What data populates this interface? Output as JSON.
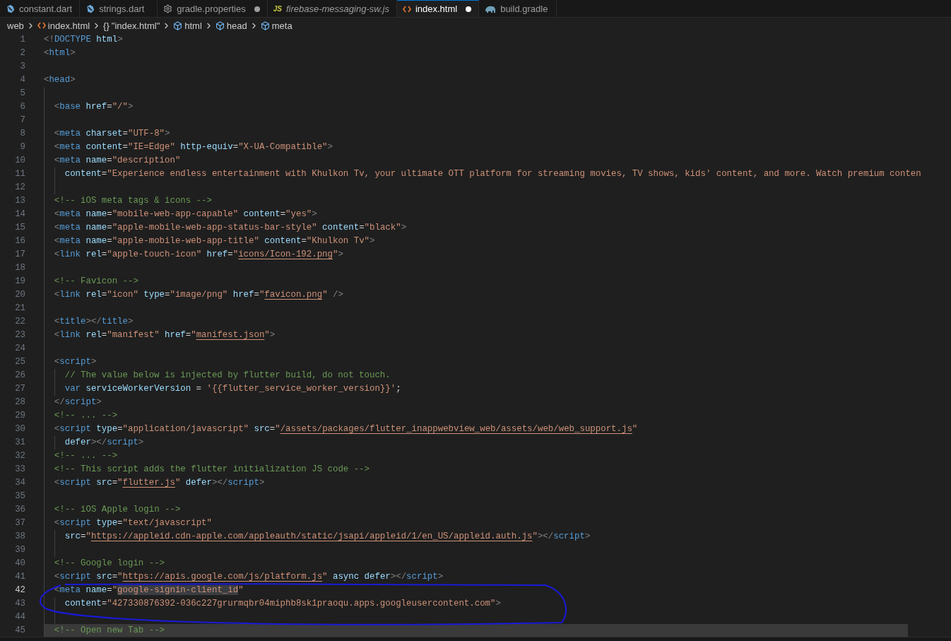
{
  "tabs": [
    {
      "label": "constant.dart",
      "kind": "dart",
      "selected": false,
      "modified": false,
      "preview": false
    },
    {
      "label": "strings.dart",
      "kind": "dart",
      "selected": false,
      "modified": false,
      "preview": false
    },
    {
      "label": "gradle.properties",
      "kind": "gear",
      "selected": false,
      "modified": true,
      "preview": false
    },
    {
      "label": "firebase-messaging-sw.js",
      "kind": "js",
      "badge": "JS",
      "selected": false,
      "modified": false,
      "preview": true
    },
    {
      "label": "index.html",
      "kind": "html",
      "selected": true,
      "modified": true,
      "preview": false
    },
    {
      "label": "build.gradle",
      "kind": "gradle",
      "selected": false,
      "modified": false,
      "preview": false
    }
  ],
  "breadcrumbs": [
    {
      "label": "web",
      "kind": "folder"
    },
    {
      "label": "index.html",
      "kind": "html"
    },
    {
      "label": "\"index.html\"",
      "kind": "braces",
      "glyph": "{}"
    },
    {
      "label": "html",
      "kind": "element"
    },
    {
      "label": "head",
      "kind": "element"
    },
    {
      "label": "meta",
      "kind": "element"
    }
  ],
  "editor": {
    "lines": [
      {
        "n": "1",
        "current": false,
        "shaded": false,
        "tokens": [
          {
            "text": "<!",
            "kind": "p"
          },
          {
            "text": "DOCTYPE",
            "kind": "tag"
          },
          {
            "text": " html",
            "kind": "attr"
          },
          {
            "text": ">",
            "kind": "p"
          }
        ]
      },
      {
        "n": "2",
        "current": false,
        "shaded": false,
        "tokens": [
          {
            "text": "<",
            "kind": "p"
          },
          {
            "text": "html",
            "kind": "tag"
          },
          {
            "text": ">",
            "kind": "p"
          }
        ]
      },
      {
        "n": "3",
        "current": false,
        "shaded": false
      },
      {
        "n": "4",
        "current": false,
        "shaded": false,
        "tokens": [
          {
            "text": "<",
            "kind": "p"
          },
          {
            "text": "head",
            "kind": "tag"
          },
          {
            "text": ">",
            "kind": "p"
          }
        ]
      },
      {
        "n": "5",
        "current": false,
        "shaded": false,
        "tokens": [
          {
            "kind": "guide"
          }
        ]
      },
      {
        "n": "6",
        "current": false,
        "shaded": false,
        "tokens": [
          {
            "kind": "guide"
          },
          {
            "text": "<",
            "kind": "p"
          },
          {
            "text": "base",
            "kind": "tag"
          },
          {
            "text": " href",
            "kind": "attr"
          },
          {
            "text": "=",
            "kind": "op"
          },
          {
            "text": "\"/\"",
            "kind": "str"
          },
          {
            "text": ">",
            "kind": "p"
          }
        ]
      },
      {
        "n": "7",
        "current": false,
        "shaded": false,
        "tokens": [
          {
            "kind": "guide"
          }
        ]
      },
      {
        "n": "8",
        "current": false,
        "shaded": false,
        "tokens": [
          {
            "kind": "guide"
          },
          {
            "text": "<",
            "kind": "p"
          },
          {
            "text": "meta",
            "kind": "tag"
          },
          {
            "text": " charset",
            "kind": "attr"
          },
          {
            "text": "=",
            "kind": "op"
          },
          {
            "text": "\"UTF-8\"",
            "kind": "str"
          },
          {
            "text": ">",
            "kind": "p"
          }
        ]
      },
      {
        "n": "9",
        "current": false,
        "shaded": false,
        "tokens": [
          {
            "kind": "guide"
          },
          {
            "text": "<",
            "kind": "p"
          },
          {
            "text": "meta",
            "kind": "tag"
          },
          {
            "text": " content",
            "kind": "attr"
          },
          {
            "text": "=",
            "kind": "op"
          },
          {
            "text": "\"IE=Edge\"",
            "kind": "str"
          },
          {
            "text": " http-equiv",
            "kind": "attr"
          },
          {
            "text": "=",
            "kind": "op"
          },
          {
            "text": "\"X-UA-Compatible\"",
            "kind": "str"
          },
          {
            "text": ">",
            "kind": "p"
          }
        ]
      },
      {
        "n": "10",
        "current": false,
        "shaded": false,
        "tokens": [
          {
            "kind": "guide"
          },
          {
            "text": "<",
            "kind": "p"
          },
          {
            "text": "meta",
            "kind": "tag"
          },
          {
            "text": " name",
            "kind": "attr"
          },
          {
            "text": "=",
            "kind": "op"
          },
          {
            "text": "\"description\"",
            "kind": "str"
          }
        ]
      },
      {
        "n": "11",
        "current": false,
        "shaded": false,
        "tokens": [
          {
            "kind": "guide"
          },
          {
            "kind": "guide"
          },
          {
            "text": "content",
            "kind": "attr"
          },
          {
            "text": "=",
            "kind": "op"
          },
          {
            "text": "\"Experience endless entertainment with Khulkon Tv, your ultimate OTT platform for streaming movies, TV shows, kids' content, and more. Watch premium conten",
            "kind": "str"
          }
        ]
      },
      {
        "n": "12",
        "current": false,
        "shaded": false,
        "tokens": [
          {
            "kind": "guide"
          },
          {
            "kind": "guide"
          }
        ]
      },
      {
        "n": "13",
        "current": false,
        "shaded": false,
        "tokens": [
          {
            "kind": "guide"
          },
          {
            "text": "<!-- iOS meta tags & icons -->",
            "kind": "com"
          }
        ]
      },
      {
        "n": "14",
        "current": false,
        "shaded": false,
        "tokens": [
          {
            "kind": "guide"
          },
          {
            "text": "<",
            "kind": "p"
          },
          {
            "text": "meta",
            "kind": "tag"
          },
          {
            "text": " name",
            "kind": "attr"
          },
          {
            "text": "=",
            "kind": "op"
          },
          {
            "text": "\"mobile-web-app-capable\"",
            "kind": "str"
          },
          {
            "text": " content",
            "kind": "attr"
          },
          {
            "text": "=",
            "kind": "op"
          },
          {
            "text": "\"yes\"",
            "kind": "str"
          },
          {
            "text": ">",
            "kind": "p"
          }
        ]
      },
      {
        "n": "15",
        "current": false,
        "shaded": false,
        "tokens": [
          {
            "kind": "guide"
          },
          {
            "text": "<",
            "kind": "p"
          },
          {
            "text": "meta",
            "kind": "tag"
          },
          {
            "text": " name",
            "kind": "attr"
          },
          {
            "text": "=",
            "kind": "op"
          },
          {
            "text": "\"apple-mobile-web-app-status-bar-style\"",
            "kind": "str"
          },
          {
            "text": " content",
            "kind": "attr"
          },
          {
            "text": "=",
            "kind": "op"
          },
          {
            "text": "\"black\"",
            "kind": "str"
          },
          {
            "text": ">",
            "kind": "p"
          }
        ]
      },
      {
        "n": "16",
        "current": false,
        "shaded": false,
        "tokens": [
          {
            "kind": "guide"
          },
          {
            "text": "<",
            "kind": "p"
          },
          {
            "text": "meta",
            "kind": "tag"
          },
          {
            "text": " name",
            "kind": "attr"
          },
          {
            "text": "=",
            "kind": "op"
          },
          {
            "text": "\"apple-mobile-web-app-title\"",
            "kind": "str"
          },
          {
            "text": " content",
            "kind": "attr"
          },
          {
            "text": "=",
            "kind": "op"
          },
          {
            "text": "\"Khulkon Tv\"",
            "kind": "str"
          },
          {
            "text": ">",
            "kind": "p"
          }
        ]
      },
      {
        "n": "17",
        "current": false,
        "shaded": false,
        "tokens": [
          {
            "kind": "guide"
          },
          {
            "text": "<",
            "kind": "p"
          },
          {
            "text": "link",
            "kind": "tag"
          },
          {
            "text": " rel",
            "kind": "attr"
          },
          {
            "text": "=",
            "kind": "op"
          },
          {
            "text": "\"apple-touch-icon\"",
            "kind": "str"
          },
          {
            "text": " href",
            "kind": "attr"
          },
          {
            "text": "=",
            "kind": "op"
          },
          {
            "text": "\"",
            "kind": "str"
          },
          {
            "text": "icons/Icon-192.png",
            "kind": "link"
          },
          {
            "text": "\"",
            "kind": "str"
          },
          {
            "text": ">",
            "kind": "p"
          }
        ]
      },
      {
        "n": "18",
        "current": false,
        "shaded": false,
        "tokens": [
          {
            "kind": "guide"
          }
        ]
      },
      {
        "n": "19",
        "current": false,
        "shaded": false,
        "tokens": [
          {
            "kind": "guide"
          },
          {
            "text": "<!-- Favicon -->",
            "kind": "com"
          }
        ]
      },
      {
        "n": "20",
        "current": false,
        "shaded": false,
        "tokens": [
          {
            "kind": "guide"
          },
          {
            "text": "<",
            "kind": "p"
          },
          {
            "text": "link",
            "kind": "tag"
          },
          {
            "text": " rel",
            "kind": "attr"
          },
          {
            "text": "=",
            "kind": "op"
          },
          {
            "text": "\"icon\"",
            "kind": "str"
          },
          {
            "text": " type",
            "kind": "attr"
          },
          {
            "text": "=",
            "kind": "op"
          },
          {
            "text": "\"image/png\"",
            "kind": "str"
          },
          {
            "text": " href",
            "kind": "attr"
          },
          {
            "text": "=",
            "kind": "op"
          },
          {
            "text": "\"",
            "kind": "str"
          },
          {
            "text": "favicon.png",
            "kind": "link"
          },
          {
            "text": "\"",
            "kind": "str"
          },
          {
            "text": " />",
            "kind": "p"
          }
        ]
      },
      {
        "n": "21",
        "current": false,
        "shaded": false,
        "tokens": [
          {
            "kind": "guide"
          }
        ]
      },
      {
        "n": "22",
        "current": false,
        "shaded": false,
        "tokens": [
          {
            "kind": "guide"
          },
          {
            "text": "<",
            "kind": "p"
          },
          {
            "text": "title",
            "kind": "tag"
          },
          {
            "text": "></",
            "kind": "p"
          },
          {
            "text": "title",
            "kind": "tag"
          },
          {
            "text": ">",
            "kind": "p"
          }
        ]
      },
      {
        "n": "23",
        "current": false,
        "shaded": false,
        "tokens": [
          {
            "kind": "guide"
          },
          {
            "text": "<",
            "kind": "p"
          },
          {
            "text": "link",
            "kind": "tag"
          },
          {
            "text": " rel",
            "kind": "attr"
          },
          {
            "text": "=",
            "kind": "op"
          },
          {
            "text": "\"manifest\"",
            "kind": "str"
          },
          {
            "text": " href",
            "kind": "attr"
          },
          {
            "text": "=",
            "kind": "op"
          },
          {
            "text": "\"",
            "kind": "str"
          },
          {
            "text": "manifest.json",
            "kind": "link"
          },
          {
            "text": "\"",
            "kind": "str"
          },
          {
            "text": ">",
            "kind": "p"
          }
        ]
      },
      {
        "n": "24",
        "current": false,
        "shaded": false,
        "tokens": [
          {
            "kind": "guide"
          }
        ]
      },
      {
        "n": "25",
        "current": false,
        "shaded": false,
        "tokens": [
          {
            "kind": "guide"
          },
          {
            "text": "<",
            "kind": "p"
          },
          {
            "text": "script",
            "kind": "tag"
          },
          {
            "text": ">",
            "kind": "p"
          }
        ]
      },
      {
        "n": "26",
        "current": false,
        "shaded": false,
        "tokens": [
          {
            "kind": "guide"
          },
          {
            "kind": "guide"
          },
          {
            "text": "// The value below is injected by flutter build, do not touch.",
            "kind": "com"
          }
        ]
      },
      {
        "n": "27",
        "current": false,
        "shaded": false,
        "tokens": [
          {
            "kind": "guide"
          },
          {
            "kind": "guide"
          },
          {
            "text": "var",
            "kind": "kw"
          },
          {
            "text": " serviceWorkerVersion",
            "kind": "var"
          },
          {
            "text": " = ",
            "kind": "op"
          },
          {
            "text": "'{{flutter_service_worker_version}}'",
            "kind": "str"
          },
          {
            "text": ";",
            "kind": "op"
          }
        ]
      },
      {
        "n": "28",
        "current": false,
        "shaded": false,
        "tokens": [
          {
            "kind": "guide"
          },
          {
            "text": "</",
            "kind": "p"
          },
          {
            "text": "script",
            "kind": "tag"
          },
          {
            "text": ">",
            "kind": "p"
          }
        ]
      },
      {
        "n": "29",
        "current": false,
        "shaded": false,
        "tokens": [
          {
            "kind": "guide"
          },
          {
            "text": "<!-- ... -->",
            "kind": "com"
          }
        ]
      },
      {
        "n": "30",
        "current": false,
        "shaded": false,
        "tokens": [
          {
            "kind": "guide"
          },
          {
            "text": "<",
            "kind": "p"
          },
          {
            "text": "script",
            "kind": "tag"
          },
          {
            "text": " type",
            "kind": "attr"
          },
          {
            "text": "=",
            "kind": "op"
          },
          {
            "text": "\"application/javascript\"",
            "kind": "str"
          },
          {
            "text": " src",
            "kind": "attr"
          },
          {
            "text": "=",
            "kind": "op"
          },
          {
            "text": "\"",
            "kind": "str"
          },
          {
            "text": "/assets/packages/flutter_inappwebview_web/assets/web/web_support.js",
            "kind": "link"
          },
          {
            "text": "\"",
            "kind": "str"
          }
        ]
      },
      {
        "n": "31",
        "current": false,
        "shaded": false,
        "tokens": [
          {
            "kind": "guide"
          },
          {
            "kind": "guide"
          },
          {
            "text": "defer",
            "kind": "attr"
          },
          {
            "text": "></",
            "kind": "p"
          },
          {
            "text": "script",
            "kind": "tag"
          },
          {
            "text": ">",
            "kind": "p"
          }
        ]
      },
      {
        "n": "32",
        "current": false,
        "shaded": false,
        "tokens": [
          {
            "kind": "guide"
          },
          {
            "text": "<!-- ... -->",
            "kind": "com"
          }
        ]
      },
      {
        "n": "33",
        "current": false,
        "shaded": false,
        "tokens": [
          {
            "kind": "guide"
          },
          {
            "text": "<!-- This script adds the flutter initialization JS code -->",
            "kind": "com"
          }
        ]
      },
      {
        "n": "34",
        "current": false,
        "shaded": false,
        "tokens": [
          {
            "kind": "guide"
          },
          {
            "text": "<",
            "kind": "p"
          },
          {
            "text": "script",
            "kind": "tag"
          },
          {
            "text": " src",
            "kind": "attr"
          },
          {
            "text": "=",
            "kind": "op"
          },
          {
            "text": "\"",
            "kind": "str"
          },
          {
            "text": "flutter.js",
            "kind": "link"
          },
          {
            "text": "\"",
            "kind": "str"
          },
          {
            "text": " defer",
            "kind": "attr"
          },
          {
            "text": "></",
            "kind": "p"
          },
          {
            "text": "script",
            "kind": "tag"
          },
          {
            "text": ">",
            "kind": "p"
          }
        ]
      },
      {
        "n": "35",
        "current": false,
        "shaded": false,
        "tokens": [
          {
            "kind": "guide"
          }
        ]
      },
      {
        "n": "36",
        "current": false,
        "shaded": false,
        "tokens": [
          {
            "kind": "guide"
          },
          {
            "text": "<!-- iOS Apple login -->",
            "kind": "com"
          }
        ]
      },
      {
        "n": "37",
        "current": false,
        "shaded": false,
        "tokens": [
          {
            "kind": "guide"
          },
          {
            "text": "<",
            "kind": "p"
          },
          {
            "text": "script",
            "kind": "tag"
          },
          {
            "text": " type",
            "kind": "attr"
          },
          {
            "text": "=",
            "kind": "op"
          },
          {
            "text": "\"text/javascript\"",
            "kind": "str"
          }
        ]
      },
      {
        "n": "38",
        "current": false,
        "shaded": false,
        "tokens": [
          {
            "kind": "guide"
          },
          {
            "kind": "guide"
          },
          {
            "text": "src",
            "kind": "attr"
          },
          {
            "text": "=",
            "kind": "op"
          },
          {
            "text": "\"",
            "kind": "str"
          },
          {
            "text": "https://appleid.cdn-apple.com/appleauth/static/jsapi/appleid/1/en_US/appleid.auth.js",
            "kind": "link"
          },
          {
            "text": "\"",
            "kind": "str"
          },
          {
            "text": "></",
            "kind": "p"
          },
          {
            "text": "script",
            "kind": "tag"
          },
          {
            "text": ">",
            "kind": "p"
          }
        ]
      },
      {
        "n": "39",
        "current": false,
        "shaded": false,
        "tokens": [
          {
            "kind": "guide"
          },
          {
            "kind": "guide"
          }
        ]
      },
      {
        "n": "40",
        "current": false,
        "shaded": false,
        "tokens": [
          {
            "kind": "guide"
          },
          {
            "text": "<!-- Google login -->",
            "kind": "com"
          }
        ]
      },
      {
        "n": "41",
        "current": false,
        "shaded": false,
        "tokens": [
          {
            "kind": "guide"
          },
          {
            "text": "<",
            "kind": "p"
          },
          {
            "text": "script",
            "kind": "tag"
          },
          {
            "text": " src",
            "kind": "attr"
          },
          {
            "text": "=",
            "kind": "op"
          },
          {
            "text": "\"",
            "kind": "str"
          },
          {
            "text": "https://apis.google.com/js/platform.js",
            "kind": "link"
          },
          {
            "text": "\"",
            "kind": "str"
          },
          {
            "text": " async",
            "kind": "attr"
          },
          {
            "text": " defer",
            "kind": "attr"
          },
          {
            "text": "></",
            "kind": "p"
          },
          {
            "text": "script",
            "kind": "tag"
          },
          {
            "text": ">",
            "kind": "p"
          }
        ]
      },
      {
        "n": "42",
        "current": true,
        "shaded": false,
        "tokens": [
          {
            "kind": "guide"
          },
          {
            "text": "<",
            "kind": "p"
          },
          {
            "text": "meta",
            "kind": "tag"
          },
          {
            "text": " name",
            "kind": "attr"
          },
          {
            "text": "=",
            "kind": "op"
          },
          {
            "text": "\"",
            "kind": "str"
          },
          {
            "text": "google-signin-client_id",
            "kind": "sel"
          },
          {
            "text": "\"",
            "kind": "str"
          }
        ]
      },
      {
        "n": "43",
        "current": false,
        "shaded": false,
        "tokens": [
          {
            "kind": "guide"
          },
          {
            "kind": "guide"
          },
          {
            "text": "content",
            "kind": "attr"
          },
          {
            "text": "=",
            "kind": "op"
          },
          {
            "text": "\"427330876392-036c227grurmqbr04miphb8sk1praoqu.apps.googleusercontent.com\"",
            "kind": "str"
          },
          {
            "text": ">",
            "kind": "p"
          }
        ]
      },
      {
        "n": "44",
        "current": false,
        "shaded": false,
        "tokens": [
          {
            "kind": "guide"
          },
          {
            "kind": "guide"
          }
        ]
      },
      {
        "n": "45",
        "current": false,
        "shaded": true,
        "tokens": [
          {
            "kind": "guide"
          },
          {
            "text": "<!-- Open new Tab -->",
            "kind": "com"
          }
        ]
      }
    ]
  },
  "annotation": {
    "kind": "scribble",
    "color": "#1a1ad8"
  }
}
